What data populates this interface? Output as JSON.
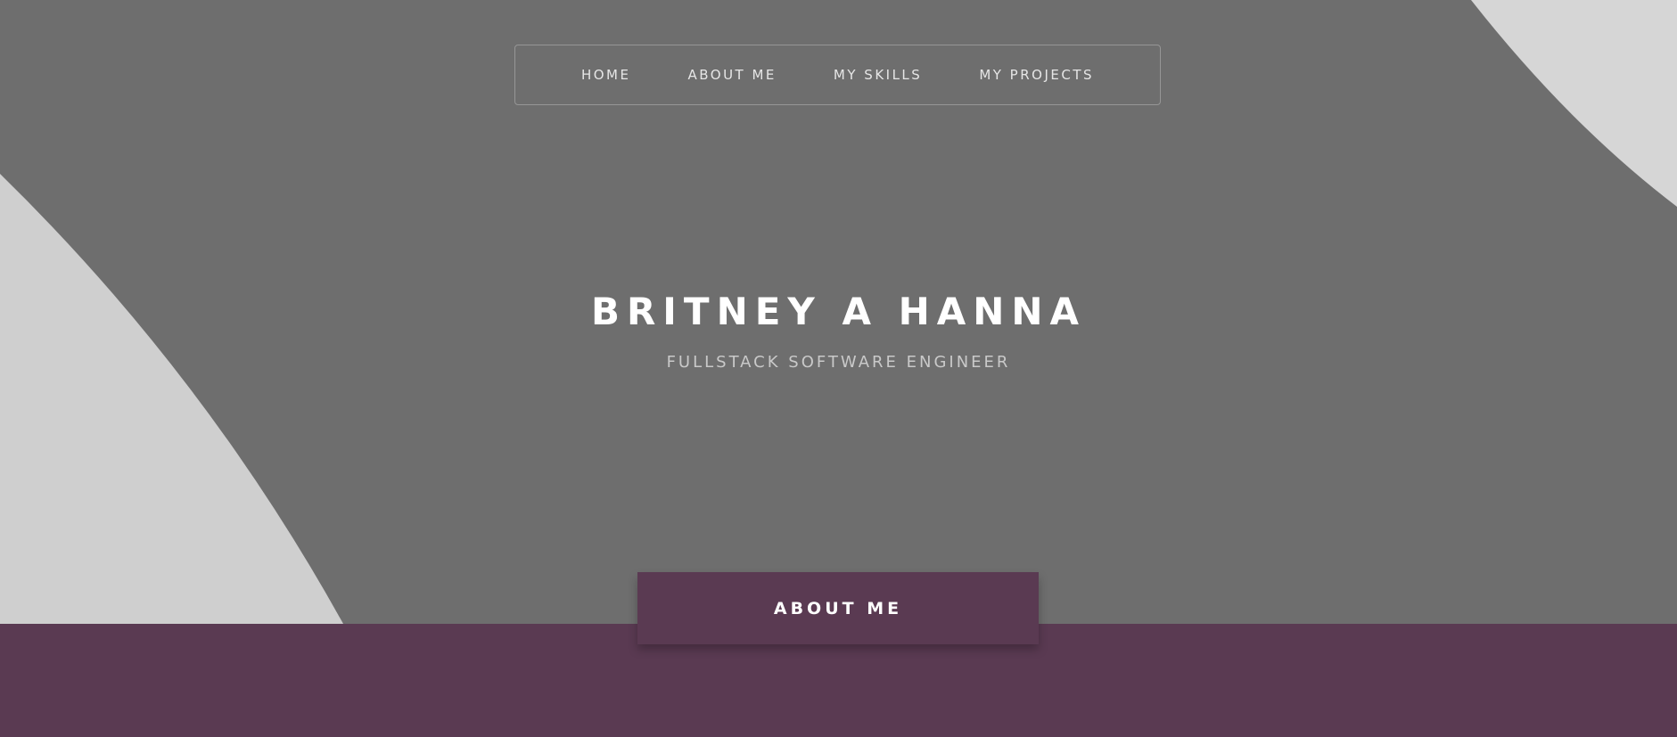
{
  "nav": {
    "items": [
      {
        "label": "HOME"
      },
      {
        "label": "ABOUT ME"
      },
      {
        "label": "MY SKILLS"
      },
      {
        "label": "MY PROJECTS"
      }
    ]
  },
  "hero": {
    "title": "BRITNEY A HANNA",
    "subtitle": "FULLSTACK SOFTWARE ENGINEER"
  },
  "about": {
    "tab_label": "ABOUT ME"
  },
  "colors": {
    "brand_purple": "#5a3a52",
    "hero_gray": "#6e6e6e",
    "light_curve": "#cfcfcf"
  }
}
